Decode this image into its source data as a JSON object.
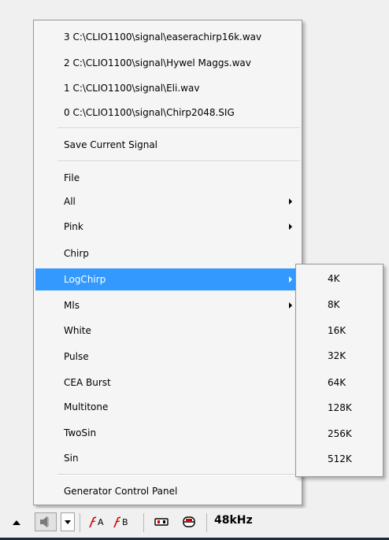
{
  "menu": {
    "recent_files": [
      {
        "label": "3 C:\\CLIO1100\\signal\\easerachirp16k.wav"
      },
      {
        "label": "2 C:\\CLIO1100\\signal\\Hywel Maggs.wav"
      },
      {
        "label": "1 C:\\CLIO1100\\signal\\Eli.wav"
      },
      {
        "label": "0 C:\\CLIO1100\\signal\\Chirp2048.SIG"
      }
    ],
    "save_current_signal": "Save Current Signal",
    "signals": [
      {
        "label": "File",
        "submenu": false
      },
      {
        "label": "All",
        "submenu": true
      },
      {
        "label": "Pink",
        "submenu": true
      },
      {
        "label": "Chirp",
        "submenu": false
      },
      {
        "label": "LogChirp",
        "submenu": true,
        "highlighted": true
      },
      {
        "label": "Mls",
        "submenu": true
      },
      {
        "label": "White",
        "submenu": false
      },
      {
        "label": "Pulse",
        "submenu": false
      },
      {
        "label": "CEA Burst",
        "submenu": false
      },
      {
        "label": "Multitone",
        "submenu": false
      },
      {
        "label": "TwoSin",
        "submenu": false
      },
      {
        "label": "Sin",
        "submenu": false
      }
    ],
    "generator_control_panel": "Generator Control Panel"
  },
  "logchirp_submenu": {
    "items": [
      "4K",
      "8K",
      "16K",
      "32K",
      "64K",
      "128K",
      "256K",
      "512K"
    ]
  },
  "toolbar": {
    "channel_a_label": "A",
    "channel_b_label": "B",
    "sample_rate": "48kHz",
    "icons": [
      "up-arrow-icon",
      "speaker-icon",
      "dropdown-arrow-icon",
      "channel-a-icon",
      "channel-b-icon",
      "input-monitor-icon",
      "output-monitor-icon"
    ]
  },
  "colors": {
    "highlight": "#3399ff",
    "menu_bg": "#f5f5f5",
    "menu_border": "#979797"
  }
}
